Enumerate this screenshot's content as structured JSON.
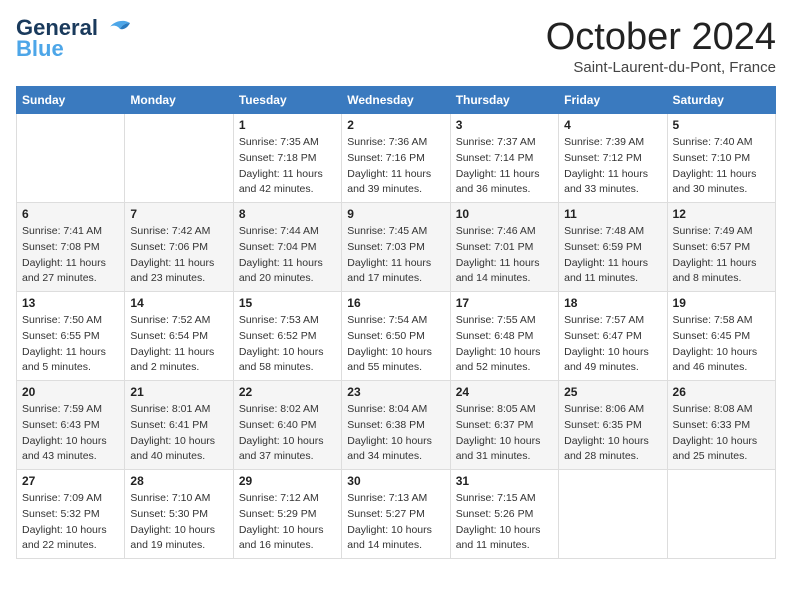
{
  "header": {
    "logo_line1": "General",
    "logo_line2": "Blue",
    "month_title": "October 2024",
    "subtitle": "Saint-Laurent-du-Pont, France"
  },
  "calendar": {
    "days_of_week": [
      "Sunday",
      "Monday",
      "Tuesday",
      "Wednesday",
      "Thursday",
      "Friday",
      "Saturday"
    ],
    "weeks": [
      [
        {
          "day": "",
          "info": ""
        },
        {
          "day": "",
          "info": ""
        },
        {
          "day": "1",
          "info": "Sunrise: 7:35 AM\nSunset: 7:18 PM\nDaylight: 11 hours and 42 minutes."
        },
        {
          "day": "2",
          "info": "Sunrise: 7:36 AM\nSunset: 7:16 PM\nDaylight: 11 hours and 39 minutes."
        },
        {
          "day": "3",
          "info": "Sunrise: 7:37 AM\nSunset: 7:14 PM\nDaylight: 11 hours and 36 minutes."
        },
        {
          "day": "4",
          "info": "Sunrise: 7:39 AM\nSunset: 7:12 PM\nDaylight: 11 hours and 33 minutes."
        },
        {
          "day": "5",
          "info": "Sunrise: 7:40 AM\nSunset: 7:10 PM\nDaylight: 11 hours and 30 minutes."
        }
      ],
      [
        {
          "day": "6",
          "info": "Sunrise: 7:41 AM\nSunset: 7:08 PM\nDaylight: 11 hours and 27 minutes."
        },
        {
          "day": "7",
          "info": "Sunrise: 7:42 AM\nSunset: 7:06 PM\nDaylight: 11 hours and 23 minutes."
        },
        {
          "day": "8",
          "info": "Sunrise: 7:44 AM\nSunset: 7:04 PM\nDaylight: 11 hours and 20 minutes."
        },
        {
          "day": "9",
          "info": "Sunrise: 7:45 AM\nSunset: 7:03 PM\nDaylight: 11 hours and 17 minutes."
        },
        {
          "day": "10",
          "info": "Sunrise: 7:46 AM\nSunset: 7:01 PM\nDaylight: 11 hours and 14 minutes."
        },
        {
          "day": "11",
          "info": "Sunrise: 7:48 AM\nSunset: 6:59 PM\nDaylight: 11 hours and 11 minutes."
        },
        {
          "day": "12",
          "info": "Sunrise: 7:49 AM\nSunset: 6:57 PM\nDaylight: 11 hours and 8 minutes."
        }
      ],
      [
        {
          "day": "13",
          "info": "Sunrise: 7:50 AM\nSunset: 6:55 PM\nDaylight: 11 hours and 5 minutes."
        },
        {
          "day": "14",
          "info": "Sunrise: 7:52 AM\nSunset: 6:54 PM\nDaylight: 11 hours and 2 minutes."
        },
        {
          "day": "15",
          "info": "Sunrise: 7:53 AM\nSunset: 6:52 PM\nDaylight: 10 hours and 58 minutes."
        },
        {
          "day": "16",
          "info": "Sunrise: 7:54 AM\nSunset: 6:50 PM\nDaylight: 10 hours and 55 minutes."
        },
        {
          "day": "17",
          "info": "Sunrise: 7:55 AM\nSunset: 6:48 PM\nDaylight: 10 hours and 52 minutes."
        },
        {
          "day": "18",
          "info": "Sunrise: 7:57 AM\nSunset: 6:47 PM\nDaylight: 10 hours and 49 minutes."
        },
        {
          "day": "19",
          "info": "Sunrise: 7:58 AM\nSunset: 6:45 PM\nDaylight: 10 hours and 46 minutes."
        }
      ],
      [
        {
          "day": "20",
          "info": "Sunrise: 7:59 AM\nSunset: 6:43 PM\nDaylight: 10 hours and 43 minutes."
        },
        {
          "day": "21",
          "info": "Sunrise: 8:01 AM\nSunset: 6:41 PM\nDaylight: 10 hours and 40 minutes."
        },
        {
          "day": "22",
          "info": "Sunrise: 8:02 AM\nSunset: 6:40 PM\nDaylight: 10 hours and 37 minutes."
        },
        {
          "day": "23",
          "info": "Sunrise: 8:04 AM\nSunset: 6:38 PM\nDaylight: 10 hours and 34 minutes."
        },
        {
          "day": "24",
          "info": "Sunrise: 8:05 AM\nSunset: 6:37 PM\nDaylight: 10 hours and 31 minutes."
        },
        {
          "day": "25",
          "info": "Sunrise: 8:06 AM\nSunset: 6:35 PM\nDaylight: 10 hours and 28 minutes."
        },
        {
          "day": "26",
          "info": "Sunrise: 8:08 AM\nSunset: 6:33 PM\nDaylight: 10 hours and 25 minutes."
        }
      ],
      [
        {
          "day": "27",
          "info": "Sunrise: 7:09 AM\nSunset: 5:32 PM\nDaylight: 10 hours and 22 minutes."
        },
        {
          "day": "28",
          "info": "Sunrise: 7:10 AM\nSunset: 5:30 PM\nDaylight: 10 hours and 19 minutes."
        },
        {
          "day": "29",
          "info": "Sunrise: 7:12 AM\nSunset: 5:29 PM\nDaylight: 10 hours and 16 minutes."
        },
        {
          "day": "30",
          "info": "Sunrise: 7:13 AM\nSunset: 5:27 PM\nDaylight: 10 hours and 14 minutes."
        },
        {
          "day": "31",
          "info": "Sunrise: 7:15 AM\nSunset: 5:26 PM\nDaylight: 10 hours and 11 minutes."
        },
        {
          "day": "",
          "info": ""
        },
        {
          "day": "",
          "info": ""
        }
      ]
    ]
  }
}
